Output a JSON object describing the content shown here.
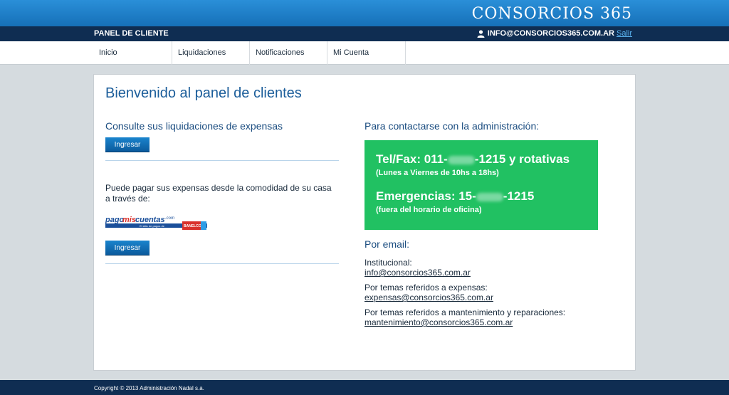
{
  "header": {
    "brand": "CONSORCIOS 365",
    "panel_label": "PANEL DE CLIENTE",
    "user_email": "INFO@CONSORCIOS365.COM.AR",
    "logout_label": "Salir"
  },
  "nav": {
    "items": [
      {
        "label": "Inicio"
      },
      {
        "label": "Liquidaciones"
      },
      {
        "label": "Notificaciones"
      },
      {
        "label": "Mi Cuenta"
      }
    ]
  },
  "main": {
    "title": "Bienvenido al panel de clientes",
    "liquidaciones_heading": "Consulte sus liquidaciones de expensas",
    "ingresar_label": "Ingresar",
    "pay_text": "Puede pagar sus expensas desde la comodidad de su casa a través de:",
    "pay_logo": {
      "name": "pagomiscuentas.com",
      "tagline": "El sitio de pagos de",
      "bank": "BANELCO"
    },
    "pay_button_label": "Ingresar",
    "contact_heading": "Para contactarse con la administración:",
    "phone_prefix": "Tel/Fax: 011-",
    "phone_suffix": "-1215 y rotativas",
    "phone_hours": "(Lunes a Viernes de 10hs a 18hs)",
    "emergency_prefix": "Emergencias: 15-",
    "emergency_suffix": "-1215",
    "emergency_note": "(fuera del horario de oficina)",
    "email_heading": "Por email:",
    "emails": [
      {
        "label": "Institucional:",
        "address": "info@consorcios365.com.ar"
      },
      {
        "label": "Por temas referidos a expensas:",
        "address": "expensas@consorcios365.com.ar"
      },
      {
        "label": "Por temas referidos a mantenimiento y reparaciones:",
        "address": "mantenimiento@consorcios365.com.ar"
      }
    ]
  },
  "footer": {
    "copyright": "Copyright © 2013 Administración Nadal s.a."
  },
  "colors": {
    "accent_blue": "#1670b8",
    "navy": "#0f2d52",
    "green_box": "#21c162"
  }
}
